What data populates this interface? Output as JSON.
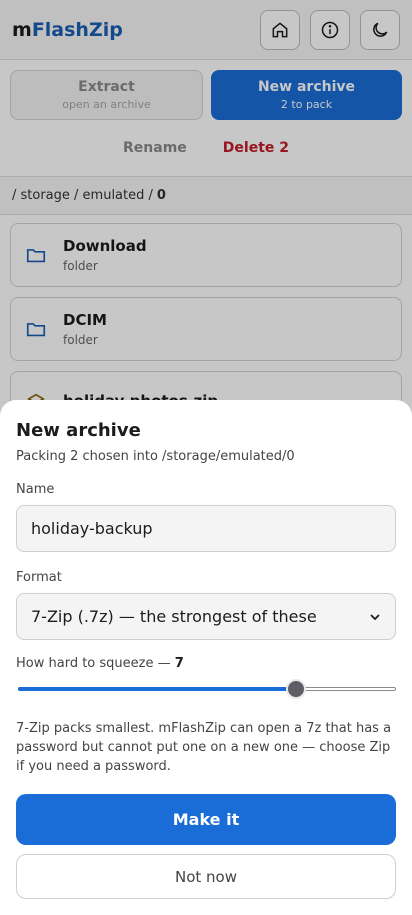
{
  "app": {
    "brand_prefix": "m",
    "brand_rest": "FlashZip",
    "header_icons": [
      "home-icon",
      "info-icon",
      "moon-icon"
    ]
  },
  "modes": {
    "extract": {
      "label": "Extract",
      "sub": "open an archive"
    },
    "new_archive": {
      "label": "New archive",
      "sub": "2 to pack"
    }
  },
  "actions": {
    "rename": "Rename",
    "delete": "Delete 2"
  },
  "breadcrumb": {
    "path": "/ storage / emulated /",
    "current": "0"
  },
  "files": [
    {
      "name": "Download",
      "kind": "folder",
      "icon": "folder-icon"
    },
    {
      "name": "DCIM",
      "kind": "folder",
      "icon": "folder-icon"
    },
    {
      "name": "holiday photos.zip",
      "kind": "",
      "icon": "archive-icon"
    }
  ],
  "sheet": {
    "title": "New archive",
    "subtitle": "Packing 2 chosen into /storage/emulated/0",
    "name_label": "Name",
    "name_value": "holiday-backup",
    "format_label": "Format",
    "format_value": "7-Zip (.7z) — the strongest of these",
    "level_label": "How hard to squeeze —",
    "level_value": "7",
    "level_min": 0,
    "level_max": 9,
    "note": "7-Zip packs smallest. mFlashZip can open a 7z that has a password but cannot put one on a new one — choose Zip if you need a password.",
    "primary_label": "Make it",
    "secondary_label": "Not now"
  },
  "colors": {
    "accent": "#1a6dd6",
    "danger": "#c01c28",
    "brand": "#1a5fb4"
  }
}
